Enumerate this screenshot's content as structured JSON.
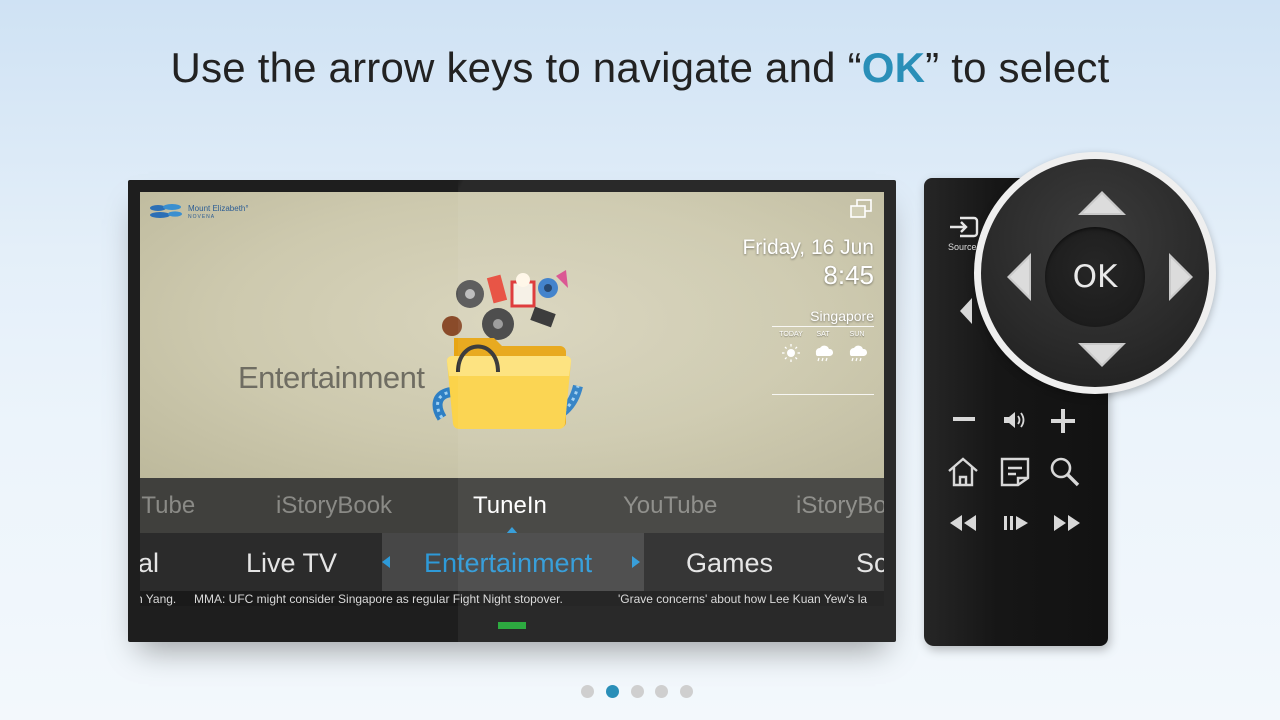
{
  "headline": {
    "prefix": "Use the arrow keys to navigate and “",
    "ok": "OK",
    "suffix": "” to select"
  },
  "tv": {
    "logo": {
      "name": "Mount Elizabeth°",
      "sub": "NOVENA"
    },
    "icons": {
      "window": "window-restore-icon",
      "folder": "entertainment-folder-icon"
    },
    "date": "Friday, 16 Jun",
    "time": "8:45",
    "weather": {
      "city": "Singapore",
      "days": [
        {
          "label": "TODAY",
          "icon": "sunny-icon"
        },
        {
          "label": "SAT",
          "icon": "rain-icon"
        },
        {
          "label": "SUN",
          "icon": "rain-icon"
        }
      ]
    },
    "hero_title": "Entertainment",
    "apps": [
      "uTube",
      "iStoryBook",
      "TuneIn",
      "YouTube",
      "iStoryBo"
    ],
    "active_app": "TuneIn",
    "categories": [
      "al",
      "Live TV",
      "Entertainment",
      "Games",
      "Sc"
    ],
    "active_category": "Entertainment",
    "ticker": [
      "n Yang.",
      "MMA: UFC might consider Singapore as regular Fight Night stopover.",
      "'Grave concerns' about how Lee Kuan Yew's la"
    ]
  },
  "remote": {
    "source_label": "Source",
    "ok_label": "OK",
    "buttons": [
      "minus-icon",
      "volume-icon",
      "plus-icon",
      "home-icon",
      "menu-icon",
      "search-icon",
      "rewind-icon",
      "play-pause-icon",
      "fast-forward-icon"
    ]
  },
  "pagination": {
    "count": 5,
    "active": 1
  },
  "colors": {
    "accent": "#2a8fb8",
    "selected_category": "#2e9ad8",
    "led": "#22a536"
  }
}
